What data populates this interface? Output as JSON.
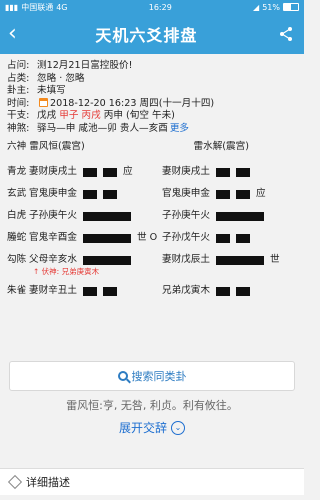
{
  "status": {
    "carrier": "中国联通",
    "network": "4G",
    "time": "16:29",
    "battery": "51%"
  },
  "nav": {
    "title": "天机六爻排盘"
  },
  "info": [
    {
      "k": "占问:",
      "v": "测12月21日富控股价!"
    },
    {
      "k": "占类:",
      "v": "忽略 · 忽略"
    },
    {
      "k": "卦主:",
      "v": "未填写"
    },
    {
      "k": "时间:",
      "v": "2018-12-20 16:23 周四",
      "extra": "(十一月十四)"
    }
  ],
  "ganzhi": {
    "k": "干支:",
    "p1": "戊戌",
    "p2": "甲子",
    "p3": "丙戌",
    "p4": "丙申",
    "p5": "(旬空 午未)"
  },
  "shensha": {
    "k": "神煞:",
    "v": "驿马—申 咸池—卯 贵人—亥酉",
    "more": "更多"
  },
  "hex": {
    "left_title": "六神 雷风恒(震宫)",
    "right_title": "雷水解(震宫)"
  },
  "lines": [
    {
      "god": "青龙",
      "l": "妻财庚戌土",
      "lmark": "应",
      "r": "妻财庚戌土"
    },
    {
      "god": "玄武",
      "l": "官鬼庚申金",
      "lmark": "",
      "r": "官鬼庚申金",
      "rmark": "应"
    },
    {
      "god": "白虎",
      "l": "子孙庚午火",
      "lmark": "",
      "r": "子孙庚午火"
    },
    {
      "god": "螣蛇",
      "l": "官鬼辛酉金",
      "lmark": "世 O",
      "r": "子孙戊午火"
    },
    {
      "god": "勾陈",
      "l": "父母辛亥水",
      "lmark": "",
      "r": "妻财戊辰土",
      "rmark": "世"
    },
    {
      "god": "朱雀",
      "l": "妻财辛丑土",
      "lmark": "",
      "r": "兄弟戊寅木"
    }
  ],
  "fushen": "↑ 伏神: 兄弟庚寅木",
  "search_btn": "搜索同类卦",
  "judgement": "雷风恒:亨, 无咎, 利贞。利有攸往。",
  "expand": "展开交辞",
  "detail": "详细描述"
}
